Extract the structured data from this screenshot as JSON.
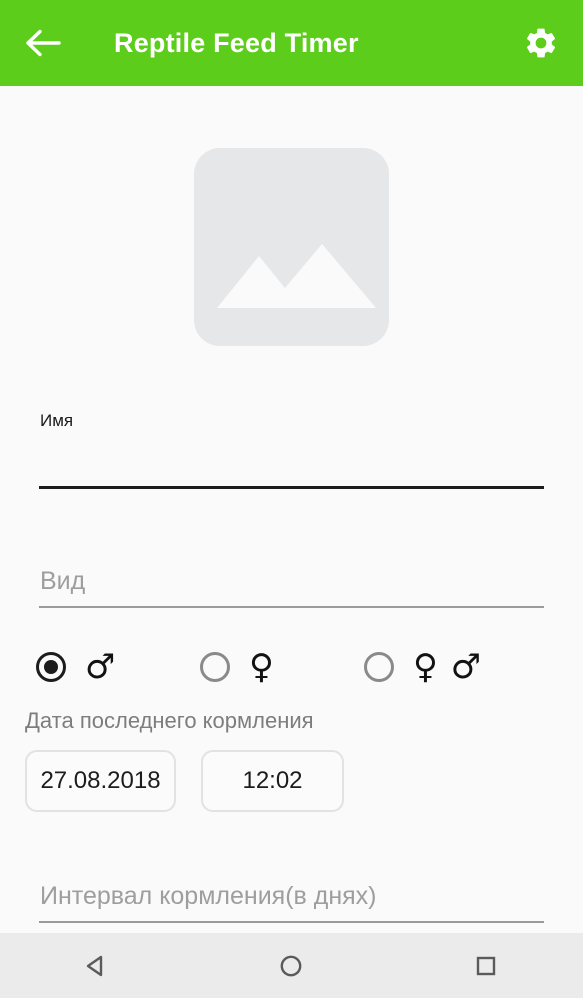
{
  "appbar": {
    "back_icon": "arrow-left-icon",
    "title": "Reptile Feed Timer",
    "settings_icon": "gear-icon",
    "background_color": "#5ccd1a",
    "title_color": "#ffffff"
  },
  "photo": {
    "icon": "image-placeholder-icon",
    "background_color": "#e6e7e8",
    "glyph_color": "#fafafa"
  },
  "form": {
    "name_field": {
      "label": "Имя",
      "value": "",
      "state": "focused",
      "underline_color": "#1c1c1c"
    },
    "species_field": {
      "placeholder": "Вид",
      "value": "",
      "state": "empty",
      "underline_color": "#9b9b9b"
    },
    "gender": {
      "selected": "male",
      "options": [
        {
          "id": "male",
          "symbol": "♂",
          "checked": true,
          "icon": "male-symbol-icon"
        },
        {
          "id": "female",
          "symbol": "♀",
          "checked": false,
          "icon": "female-symbol-icon"
        },
        {
          "id": "both",
          "symbol": "♀ ♂",
          "checked": false,
          "icon": "female-male-symbol-icon"
        }
      ]
    },
    "last_feeding": {
      "section_label": "Дата последнего кормления",
      "date_value": "27.08.2018",
      "time_value": "12:02"
    },
    "interval_field": {
      "placeholder": "Интервал кормления(в днях)",
      "value": "",
      "state": "empty",
      "underline_color": "#9b9b9b"
    }
  },
  "navbar": {
    "background_color": "#ebebeb",
    "buttons": [
      {
        "id": "back",
        "icon": "nav-back-triangle-icon"
      },
      {
        "id": "home",
        "icon": "nav-home-circle-icon"
      },
      {
        "id": "recents",
        "icon": "nav-recents-square-icon"
      }
    ]
  }
}
